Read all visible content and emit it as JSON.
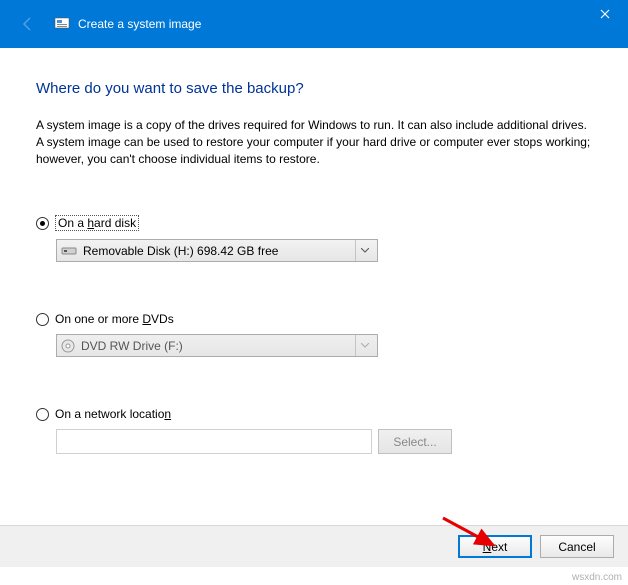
{
  "titlebar": {
    "title": "Create a system image"
  },
  "heading": "Where do you want to save the backup?",
  "description": "A system image is a copy of the drives required for Windows to run. It can also include additional drives. A system image can be used to restore your computer if your hard drive or computer ever stops working; however, you can't choose individual items to restore.",
  "options": {
    "harddisk": {
      "label_pre": "On a ",
      "label_key": "h",
      "label_post": "ard disk",
      "dropdown": "Removable Disk (H:)  698.42 GB free"
    },
    "dvd": {
      "label_pre": "On one or more ",
      "label_key": "D",
      "label_post": "VDs",
      "dropdown": "DVD RW Drive (F:)"
    },
    "network": {
      "label_pre": "On a network locatio",
      "label_key": "n",
      "label_post": "",
      "select_button": "Select..."
    }
  },
  "footer": {
    "next_pre": "",
    "next_key": "N",
    "next_post": "ext",
    "cancel": "Cancel"
  },
  "watermark": "wsxdn.com"
}
